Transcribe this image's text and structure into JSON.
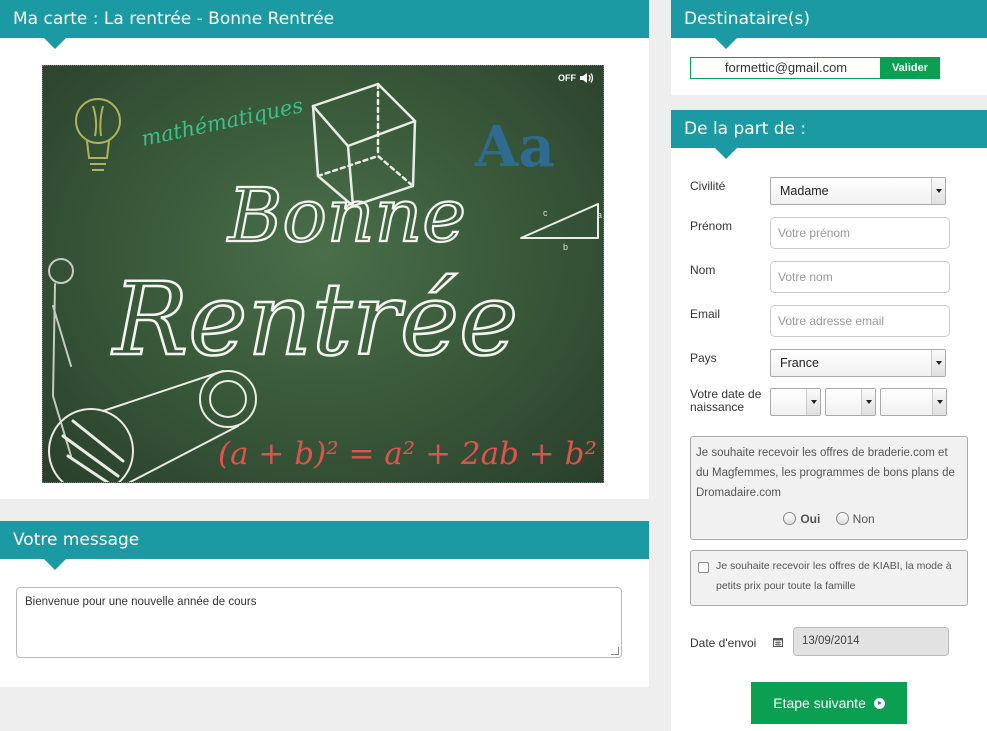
{
  "card": {
    "header": "Ma carte : La rentrée - Bonne Rentrée",
    "sound_label": "OFF",
    "chalk": {
      "word1": "Bonne",
      "word2": "Rentrée",
      "subject": "mathématiques",
      "letters": "Aa",
      "formula": "(a + b)² = a² + 2ab + b²",
      "tri_c": "c",
      "tri_b": "b",
      "tri_a": "a"
    }
  },
  "message": {
    "header": "Votre message",
    "text": "Bienvenue pour une nouvelle année de cours"
  },
  "recipients": {
    "header": "Destinataire(s)",
    "email": "formettic@gmail.com",
    "validate_label": "Valider"
  },
  "sender": {
    "header": "De la part de :",
    "civility_label": "Civilité",
    "civility_value": "Madame",
    "firstname_label": "Prénom",
    "firstname_placeholder": "Votre prénom",
    "lastname_label": "Nom",
    "lastname_placeholder": "Votre nom",
    "email_label": "Email",
    "email_placeholder": "Votre adresse email",
    "country_label": "Pays",
    "country_value": "France",
    "birthdate_label": "Votre date de naissance",
    "offers_text": "Je souhaite recevoir les offres de braderie.com et du Magfemmes, les programmes de bons plans de Dromadaire.com",
    "offers_yes": "Oui",
    "offers_no": "Non",
    "kiabi_text": "Je souhaite recevoir les offres de KIABI, la mode à petits prix pour toute la famille",
    "send_date_label": "Date d'envoi",
    "send_date_value": "13/09/2014",
    "next_label": "Etape suivante"
  },
  "colors": {
    "header_teal": "#1b9aa3",
    "button_green": "#0a9f51",
    "board_green": "#3a5b3b"
  }
}
